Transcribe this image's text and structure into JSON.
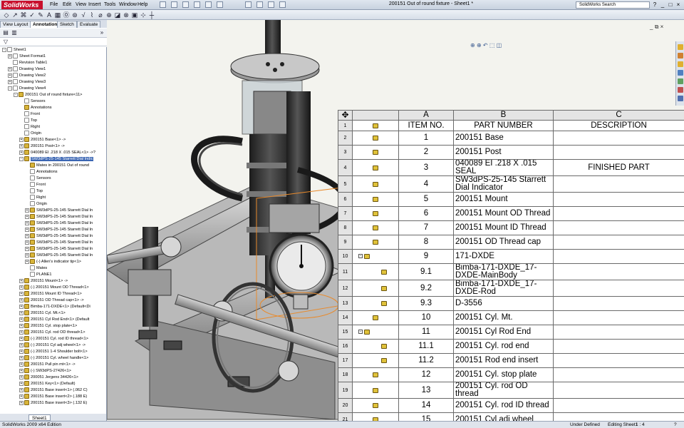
{
  "app": {
    "logo": "SolidWorks",
    "title": "200151 Out of round fixture - Sheet1 *",
    "menu": [
      "File",
      "Edit",
      "View",
      "Insert",
      "Tools",
      "Window",
      "Help"
    ],
    "search_placeholder": "SolidWorks Search",
    "win_buttons": [
      "?",
      "_",
      "□",
      "×"
    ]
  },
  "toolbar_icons": [
    "sketch-icon",
    "line-icon",
    "arc-icon",
    "note-icon",
    "balloon-icon",
    "table-icon"
  ],
  "left_panel": {
    "tabs": [
      "View Layout",
      "Annotation",
      "Sketch",
      "Evaluate"
    ],
    "active_tab": "Annotation",
    "tree": [
      {
        "indent": 0,
        "exp": "-",
        "icon": "plain",
        "label": "Sheet1"
      },
      {
        "indent": 1,
        "exp": "+",
        "icon": "plain",
        "label": "Sheet Format1"
      },
      {
        "indent": 1,
        "exp": "",
        "icon": "plain",
        "label": "Revision Table1"
      },
      {
        "indent": 1,
        "exp": "+",
        "icon": "plain",
        "label": "Drawing View1"
      },
      {
        "indent": 1,
        "exp": "+",
        "icon": "plain",
        "label": "Drawing View2"
      },
      {
        "indent": 1,
        "exp": "+",
        "icon": "plain",
        "label": "Drawing View3"
      },
      {
        "indent": 1,
        "exp": "-",
        "icon": "plain",
        "label": "Drawing View4"
      },
      {
        "indent": 2,
        "exp": "-",
        "icon": "part",
        "label": "200151 Out of round fixture<11>"
      },
      {
        "indent": 3,
        "exp": "",
        "icon": "plain",
        "label": "Sensors"
      },
      {
        "indent": 3,
        "exp": "",
        "icon": "part",
        "label": "Annotations"
      },
      {
        "indent": 3,
        "exp": "",
        "icon": "plain",
        "label": "Front"
      },
      {
        "indent": 3,
        "exp": "",
        "icon": "plain",
        "label": "Top"
      },
      {
        "indent": 3,
        "exp": "",
        "icon": "plain",
        "label": "Right"
      },
      {
        "indent": 3,
        "exp": "",
        "icon": "plain",
        "label": "Origin"
      },
      {
        "indent": 3,
        "exp": "+",
        "icon": "part",
        "label": "200151 Base<1> ->"
      },
      {
        "indent": 3,
        "exp": "+",
        "icon": "part",
        "label": "200151 Post<1> ->"
      },
      {
        "indent": 3,
        "exp": "+",
        "icon": "part",
        "label": "040089 EI .218 X .015  SEAL<1> ->?"
      },
      {
        "indent": 3,
        "exp": "-",
        "icon": "part",
        "label": "SW3dPS-25-145 Starrett Dial Indic",
        "selected": true
      },
      {
        "indent": 4,
        "exp": "",
        "icon": "part",
        "label": "Mates in 200151 Out of round"
      },
      {
        "indent": 4,
        "exp": "",
        "icon": "plain",
        "label": "Annotations"
      },
      {
        "indent": 4,
        "exp": "",
        "icon": "plain",
        "label": "Sensors"
      },
      {
        "indent": 4,
        "exp": "",
        "icon": "plain",
        "label": "Front"
      },
      {
        "indent": 4,
        "exp": "",
        "icon": "plain",
        "label": "Top"
      },
      {
        "indent": 4,
        "exp": "",
        "icon": "plain",
        "label": "Right"
      },
      {
        "indent": 4,
        "exp": "",
        "icon": "plain",
        "label": "Origin"
      },
      {
        "indent": 4,
        "exp": "+",
        "icon": "part",
        "label": "SW3dPS-25-145 Starrett Dial In"
      },
      {
        "indent": 4,
        "exp": "+",
        "icon": "part",
        "label": "SW3dPS-25-145 Starrett Dial In"
      },
      {
        "indent": 4,
        "exp": "+",
        "icon": "part",
        "label": "SW3dPS-25-145 Starrett Dial In"
      },
      {
        "indent": 4,
        "exp": "+",
        "icon": "part",
        "label": "SW3dPS-25-145 Starrett Dial In"
      },
      {
        "indent": 4,
        "exp": "+",
        "icon": "part",
        "label": "SW3dPS-25-145 Starrett Dial In"
      },
      {
        "indent": 4,
        "exp": "+",
        "icon": "part",
        "label": "SW3dPS-25-145 Starrett Dial In"
      },
      {
        "indent": 4,
        "exp": "+",
        "icon": "part",
        "label": "SW3dPS-25-145 Starrett Dial In"
      },
      {
        "indent": 4,
        "exp": "+",
        "icon": "part",
        "label": "SW3dPS-25-145 Starrett Dial In"
      },
      {
        "indent": 4,
        "exp": "+",
        "icon": "part",
        "label": "(-) Allen's indicator tip<1>"
      },
      {
        "indent": 4,
        "exp": "",
        "icon": "plain",
        "label": "Mates"
      },
      {
        "indent": 4,
        "exp": "",
        "icon": "plain",
        "label": "PLANE1"
      },
      {
        "indent": 3,
        "exp": "+",
        "icon": "part",
        "label": "200151 Mount<1> ->"
      },
      {
        "indent": 3,
        "exp": "+",
        "icon": "part",
        "label": "(-) 200151 Mount OD Thread<1>"
      },
      {
        "indent": 3,
        "exp": "+",
        "icon": "part",
        "label": "200151 Mount ID Thread<1>"
      },
      {
        "indent": 3,
        "exp": "+",
        "icon": "part",
        "label": "200151 OD Thread cap<1> ->"
      },
      {
        "indent": 3,
        "exp": "+",
        "icon": "part",
        "label": "Bimba-171-DXDE<1> (Default<Di"
      },
      {
        "indent": 3,
        "exp": "+",
        "icon": "part",
        "label": "200151 Cyl. Mt.<1>"
      },
      {
        "indent": 3,
        "exp": "+",
        "icon": "part",
        "label": "200151 Cyl Rod End<1> (Default"
      },
      {
        "indent": 3,
        "exp": "+",
        "icon": "part",
        "label": "200151 Cyl. stop plate<1>"
      },
      {
        "indent": 3,
        "exp": "+",
        "icon": "part",
        "label": "200151 Cyl. rod OD thread<1>"
      },
      {
        "indent": 3,
        "exp": "+",
        "icon": "part",
        "label": "(-) 200151 Cyl. rod ID thread<1>"
      },
      {
        "indent": 3,
        "exp": "+",
        "icon": "part",
        "label": "(-) 200151 Cyl adj wheel<1> ->"
      },
      {
        "indent": 3,
        "exp": "+",
        "icon": "part",
        "label": "(-) 200151 1-4 Shoulder bolt<1>"
      },
      {
        "indent": 3,
        "exp": "+",
        "icon": "part",
        "label": "(-) 200151 Cyl. wheel handle<1>"
      },
      {
        "indent": 3,
        "exp": "+",
        "icon": "part",
        "label": "200151 Pull pin mt<1> ->"
      },
      {
        "indent": 3,
        "exp": "+",
        "icon": "part",
        "label": "(-) SW3dPS-27426<1>"
      },
      {
        "indent": 3,
        "exp": "+",
        "icon": "part",
        "label": "200051 Jergens 34426<1>"
      },
      {
        "indent": 3,
        "exp": "+",
        "icon": "part",
        "label": "200151 Key<1> (Default)"
      },
      {
        "indent": 3,
        "exp": "+",
        "icon": "part",
        "label": "200151 Base insert<1> (.062 C)"
      },
      {
        "indent": 3,
        "exp": "+",
        "icon": "part",
        "label": "200151 Base insert<2> (.188 E)"
      },
      {
        "indent": 3,
        "exp": "+",
        "icon": "part",
        "label": "200151 Base insert<3> (.132 E)"
      }
    ],
    "sheet_tab": "Sheet1"
  },
  "bom": {
    "columns": [
      "A",
      "B",
      "C"
    ],
    "headers": [
      "ITEM NO.",
      "PART NUMBER",
      "DESCRIPTION"
    ],
    "rows": [
      {
        "num": "2",
        "item": "1",
        "part": "200151 Base",
        "desc": "",
        "indent": 0
      },
      {
        "num": "3",
        "item": "2",
        "part": "200151 Post",
        "desc": "",
        "indent": 0
      },
      {
        "num": "4",
        "item": "3",
        "part": "040089 EI .218 X .015 SEAL",
        "desc": "FINISHED PART",
        "indent": 0
      },
      {
        "num": "5",
        "item": "4",
        "part": "SW3dPS-25-145 Starrett Dial Indicator",
        "desc": "",
        "indent": 0
      },
      {
        "num": "6",
        "item": "5",
        "part": "200151 Mount",
        "desc": "",
        "indent": 0
      },
      {
        "num": "7",
        "item": "6",
        "part": "200151 Mount OD Thread",
        "desc": "",
        "indent": 0
      },
      {
        "num": "8",
        "item": "7",
        "part": "200151 Mount ID Thread",
        "desc": "",
        "indent": 0
      },
      {
        "num": "9",
        "item": "8",
        "part": "200151 OD Thread cap",
        "desc": "",
        "indent": 0
      },
      {
        "num": "10",
        "item": "9",
        "part": "171-DXDE",
        "desc": "",
        "indent": 0,
        "collapse": "⊟"
      },
      {
        "num": "11",
        "item": "9.1",
        "part": " Bimba-171-DXDE_17-DXDE-MainBody",
        "desc": "",
        "indent": 1
      },
      {
        "num": "12",
        "item": "9.2",
        "part": " Bimba-171-DXDE_17-DXDE-Rod",
        "desc": "",
        "indent": 1
      },
      {
        "num": "13",
        "item": "9.3",
        "part": " D-3556",
        "desc": "",
        "indent": 1
      },
      {
        "num": "14",
        "item": "10",
        "part": "200151 Cyl. Mt.",
        "desc": "",
        "indent": 0
      },
      {
        "num": "15",
        "item": "11",
        "part": "200151 Cyl Rod End",
        "desc": "",
        "indent": 0,
        "collapse": "⊟"
      },
      {
        "num": "16",
        "item": "11.1",
        "part": " 200151 Cyl. rod end",
        "desc": "",
        "indent": 1
      },
      {
        "num": "17",
        "item": "11.2",
        "part": " 200151 Rod end insert",
        "desc": "",
        "indent": 1
      },
      {
        "num": "18",
        "item": "12",
        "part": "200151 Cyl. stop plate",
        "desc": "",
        "indent": 0
      },
      {
        "num": "19",
        "item": "13",
        "part": "200151 Cyl. rod OD thread",
        "desc": "",
        "indent": 0
      },
      {
        "num": "20",
        "item": "14",
        "part": "200151 Cyl. rod ID thread",
        "desc": "",
        "indent": 0
      },
      {
        "num": "21",
        "item": "15",
        "part": "200151 Cyl adj wheel",
        "desc": "",
        "indent": 0
      }
    ]
  },
  "status": {
    "edition": "SolidWorks 2009 x64 Edition",
    "state": "Under Defined",
    "editing": "Editing Sheet1",
    "scale": "1 : 4"
  },
  "colors": {
    "selection": "#3b66b3",
    "part_icon": "#e0c23a",
    "metal": "#2d2d2d",
    "model_highlight": "#e88a2c"
  }
}
